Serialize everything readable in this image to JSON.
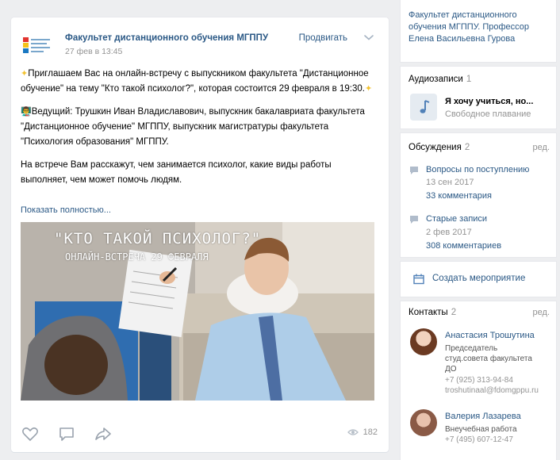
{
  "post": {
    "author": "Факультет дистанционного обучения МГППУ",
    "date": "27 фев в 13:45",
    "promote_label": "Продвигать",
    "paragraph1": "Приглашаем Вас на онлайн-встречу с выпускником факультета \"Дистанционное обучение\" на тему \"Кто такой психолог?\", которая состоится 29 февраля в 19:30.",
    "paragraph2": "Ведущий: Трушкин Иван Владиславович, выпускник бакалавриата факультета \"Дистанционное обучение\" МГППУ, выпускник магистратуры факультета \"Психология образования\" МГППУ.",
    "paragraph3": "На встрече Вам расскажут, чем занимается психолог, какие виды работы выполняет, чем может помочь людям.",
    "show_more": "Показать полностью...",
    "image_title": "\"КТО ТАКОЙ ПСИХОЛОГ?\"",
    "image_subtitle": "ОНЛАЙН-ВСТРЕЧА 29 ФЕВРАЛЯ",
    "views": "182"
  },
  "sidebar": {
    "top_text_line1": "Факультет дистанционного",
    "top_text_line2": "обучения МГППУ. Профессор",
    "top_text_line3": "Елена Васильевна Гурова",
    "audio": {
      "title": "Аудиозаписи",
      "count": "1",
      "track_title": "Я хочу учиться, но...",
      "track_artist": "Свободное плавание"
    },
    "discussions": {
      "title": "Обсуждения",
      "count": "2",
      "edit": "ред.",
      "items": [
        {
          "title": "Вопросы по поступлению",
          "date": "13 сен 2017",
          "comments": "33 комментария"
        },
        {
          "title": "Старые записи",
          "date": "2 фев 2017",
          "comments": "308 комментариев"
        }
      ]
    },
    "create_event": "Создать мероприятие",
    "contacts": {
      "title": "Контакты",
      "count": "2",
      "edit": "ред.",
      "items": [
        {
          "name": "Анастасия Трошутина",
          "role1": "Председатель",
          "role2": "студ.совета факультета",
          "role3": "ДО",
          "phone": "+7 (925) 313-94-84",
          "email": "troshutinaal@fdomgppu.ru"
        },
        {
          "name": "Валерия Лазарева",
          "role1": "Внеучебная работа",
          "phone": "+7 (495) 607-12-47"
        }
      ]
    }
  },
  "colors": {
    "link": "#2a5885",
    "muted": "#939393",
    "background": "#edeef0"
  }
}
